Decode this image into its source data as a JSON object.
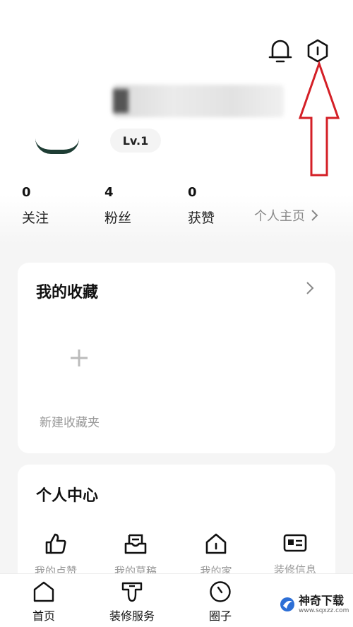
{
  "header": {
    "bell_icon": "bell-icon",
    "settings_icon": "hexagon-settings-icon"
  },
  "profile": {
    "level": "Lv.1"
  },
  "stats": [
    {
      "value": "0",
      "label": "关注"
    },
    {
      "value": "4",
      "label": "粉丝"
    },
    {
      "value": "0",
      "label": "获赞"
    }
  ],
  "homepage_link": "个人主页",
  "favorites": {
    "title": "我的收藏",
    "new_folder": "新建收藏夹"
  },
  "personal_center": {
    "title": "个人中心",
    "items": [
      {
        "label": "我的点赞",
        "icon": "thumbs-up-icon"
      },
      {
        "label": "我的草稿",
        "icon": "draft-box-icon"
      },
      {
        "label": "我的家",
        "icon": "house-icon"
      },
      {
        "label": "装修信息",
        "icon": "id-card-icon"
      }
    ]
  },
  "bottom_nav": [
    {
      "label": "首页",
      "icon": "home-icon"
    },
    {
      "label": "装修服务",
      "icon": "service-icon"
    },
    {
      "label": "圈子",
      "icon": "circle-icon"
    }
  ],
  "watermark": {
    "text": "神奇下载",
    "sub": "www.sqxzz.com"
  },
  "colors": {
    "annotation_red": "#d41f26",
    "background": "#f5f5f5"
  }
}
